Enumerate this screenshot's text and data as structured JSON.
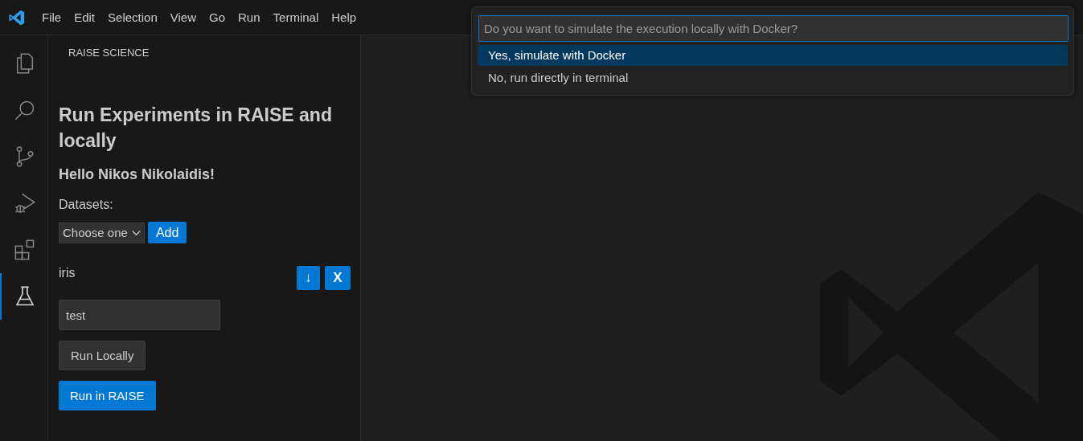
{
  "menu_bar": {
    "items": [
      "File",
      "Edit",
      "Selection",
      "View",
      "Go",
      "Run",
      "Terminal",
      "Help"
    ]
  },
  "activity_bar": {
    "items": [
      {
        "kind": "files",
        "selected": false
      },
      {
        "kind": "search",
        "selected": false
      },
      {
        "kind": "source-control",
        "selected": false
      },
      {
        "kind": "run-debug",
        "selected": false
      },
      {
        "kind": "extensions",
        "selected": false
      },
      {
        "kind": "flask",
        "selected": true
      }
    ]
  },
  "sidebar": {
    "title": "RAISE SCIENCE",
    "heading": "Run Experiments in RAISE and locally",
    "greeting": "Hello Nikos Nikolaidis!",
    "datasets_label": "Datasets:",
    "dataset_select": {
      "value": "Choose one"
    },
    "add_button": "Add",
    "datasets": [
      {
        "name": "iris",
        "download_button": "↓",
        "remove_button": "X"
      }
    ],
    "name_field": {
      "value": "test"
    },
    "buttons": [
      {
        "label": "Run Locally",
        "kind": "secondary"
      },
      {
        "label": "Run in RAISE",
        "kind": "primary"
      }
    ]
  },
  "quick_pick": {
    "placeholder": "Do you want to simulate the execution locally with Docker?",
    "options": [
      {
        "label": "Yes, simulate with Docker",
        "selected": true
      },
      {
        "label": "No, run directly in terminal",
        "selected": false
      }
    ]
  }
}
